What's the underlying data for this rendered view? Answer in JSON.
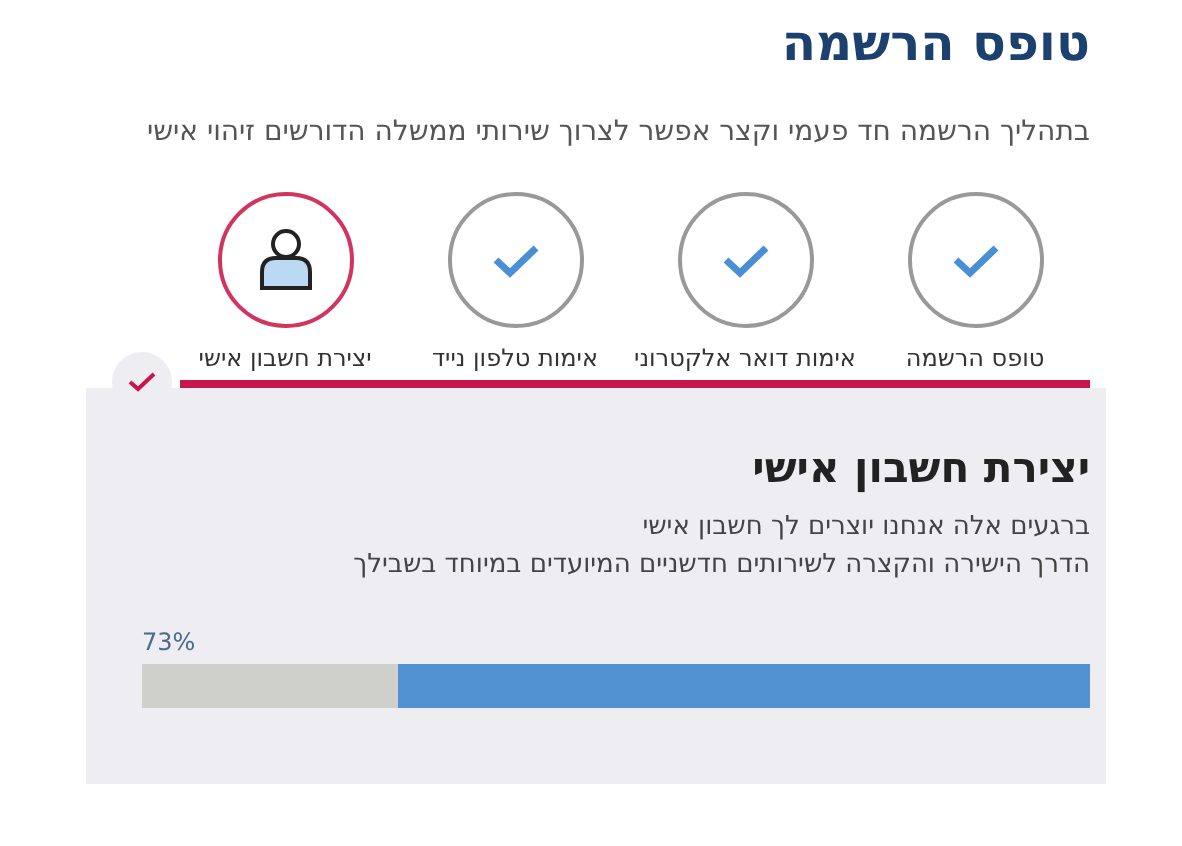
{
  "title": "טופס הרשמה",
  "subtitle": "בתהליך הרשמה חד פעמי וקצר אפשר לצרוך שירותי ממשלה הדורשים זיהוי אישי",
  "steps": [
    {
      "label": "טופס הרשמה",
      "done": true
    },
    {
      "label": "אימות דואר אלקטרוני",
      "done": true
    },
    {
      "label": "אימות טלפון נייד",
      "done": true
    },
    {
      "label": "יצירת חשבון אישי",
      "done": false
    }
  ],
  "panel": {
    "heading": "יצירת חשבון אישי",
    "lines": [
      "ברגעים אלה אנחנו יוצרים לך חשבון אישי",
      "הדרך הישירה והקצרה לשירותים חדשניים המיועדים במיוחד בשבילך"
    ],
    "progress": {
      "reading": "73%",
      "level": 0.73
    }
  }
}
